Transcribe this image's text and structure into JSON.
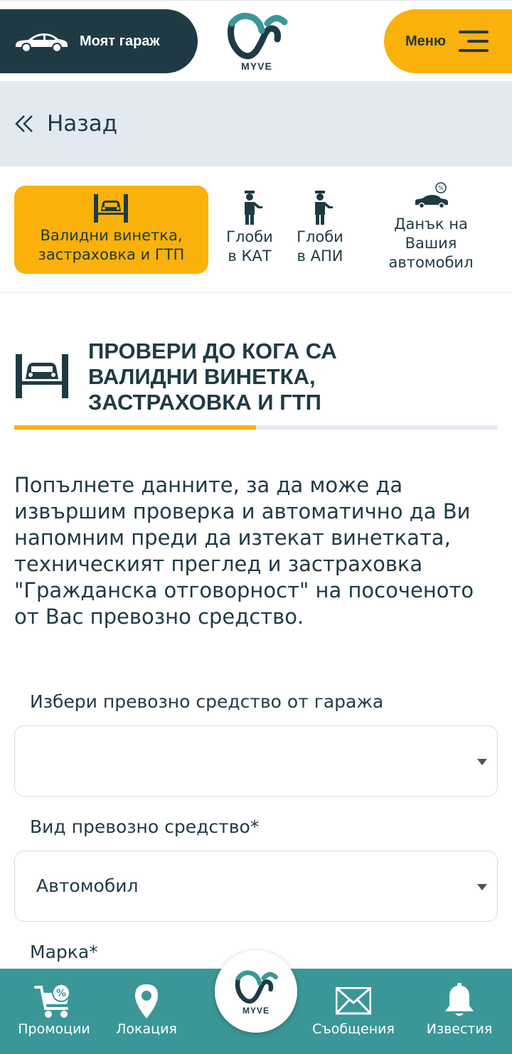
{
  "header": {
    "garage_label": "Моят гараж",
    "logo_text": "MYVE",
    "menu_label": "Меню"
  },
  "back": {
    "label": "Назад"
  },
  "tabs": [
    {
      "label_line1": "Валидни винетка,",
      "label_line2": "застраховка и ГТП",
      "active": true
    },
    {
      "label_line1": "Глоби",
      "label_line2": "в КАТ"
    },
    {
      "label_line1": "Глоби",
      "label_line2": "в АПИ"
    },
    {
      "label_line1": "Данък на",
      "label_line2": "Вашия",
      "label_line3": "автомобил"
    }
  ],
  "section": {
    "title_line1": "ПРОВЕРИ ДО КОГА СА",
    "title_line2": "ВАЛИДНИ ВИНЕТКА,",
    "title_line3": "ЗАСТРАХОВКА И ГТП",
    "progress": 0.5
  },
  "description": "Попълнете данните, за да може да извършим проверка и автоматично да Ви напомним преди да изтекат винетката, техническият преглед и застраховка \"Гражданска отговорност\" на посоченото от Вас превозно средство.",
  "form": {
    "garage_select_label": "Избери превозно средство от гаража",
    "garage_select_value": "",
    "vehicle_type_label": "Вид превозно средство*",
    "vehicle_type_value": "Автомобил",
    "brand_label": "Марка*"
  },
  "bottom_nav": {
    "promotions": "Промоции",
    "location": "Локация",
    "logo_text": "MYVE",
    "messages": "Съобщения",
    "notifications": "Известия"
  },
  "colors": {
    "primary_dark": "#1f3a44",
    "accent_yellow": "#fbb10b",
    "teal": "#3b9797",
    "back_bg": "#e3e9f0"
  }
}
